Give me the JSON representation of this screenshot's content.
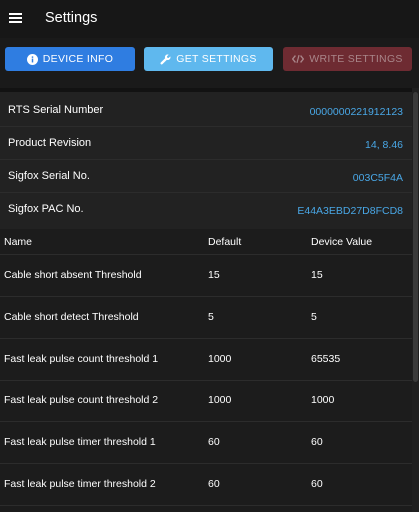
{
  "app": {
    "title": "Settings"
  },
  "toolbar": {
    "device_info_label": "Device Info",
    "get_settings_label": "Get Settings",
    "write_settings_label": "Write Settings"
  },
  "device": [
    {
      "label": "RTS Serial Number",
      "value": "0000000221912123"
    },
    {
      "label": "Product Revision",
      "value": "14, 8.46"
    },
    {
      "label": "Sigfox Serial No.",
      "value": "003C5F4A"
    },
    {
      "label": "Sigfox PAC No.",
      "value": "E44A3EBD27D8FCD8"
    }
  ],
  "table": {
    "headers": [
      "Name",
      "Default",
      "Device Value"
    ],
    "rows": [
      {
        "name": "Cable short absent Threshold",
        "default": "15",
        "device": "15"
      },
      {
        "name": "Cable short detect Threshold",
        "default": "5",
        "device": "5"
      },
      {
        "name": "Fast leak pulse count threshold 1",
        "default": "1000",
        "device": "65535"
      },
      {
        "name": "Fast leak pulse count threshold 2",
        "default": "1000",
        "device": "1000"
      },
      {
        "name": "Fast leak pulse timer threshold 1",
        "default": "60",
        "device": "60"
      },
      {
        "name": "Fast leak pulse timer threshold 2",
        "default": "60",
        "device": "60"
      }
    ]
  },
  "icons": {
    "menu": "menu-icon",
    "info": "info-icon",
    "wrench": "wrench-icon",
    "code": "code-icon"
  },
  "colors": {
    "primary": "#2f7de1",
    "secondary": "#5fb8ee",
    "disabled": "#6e2b32",
    "value_text": "#49a7e6"
  }
}
